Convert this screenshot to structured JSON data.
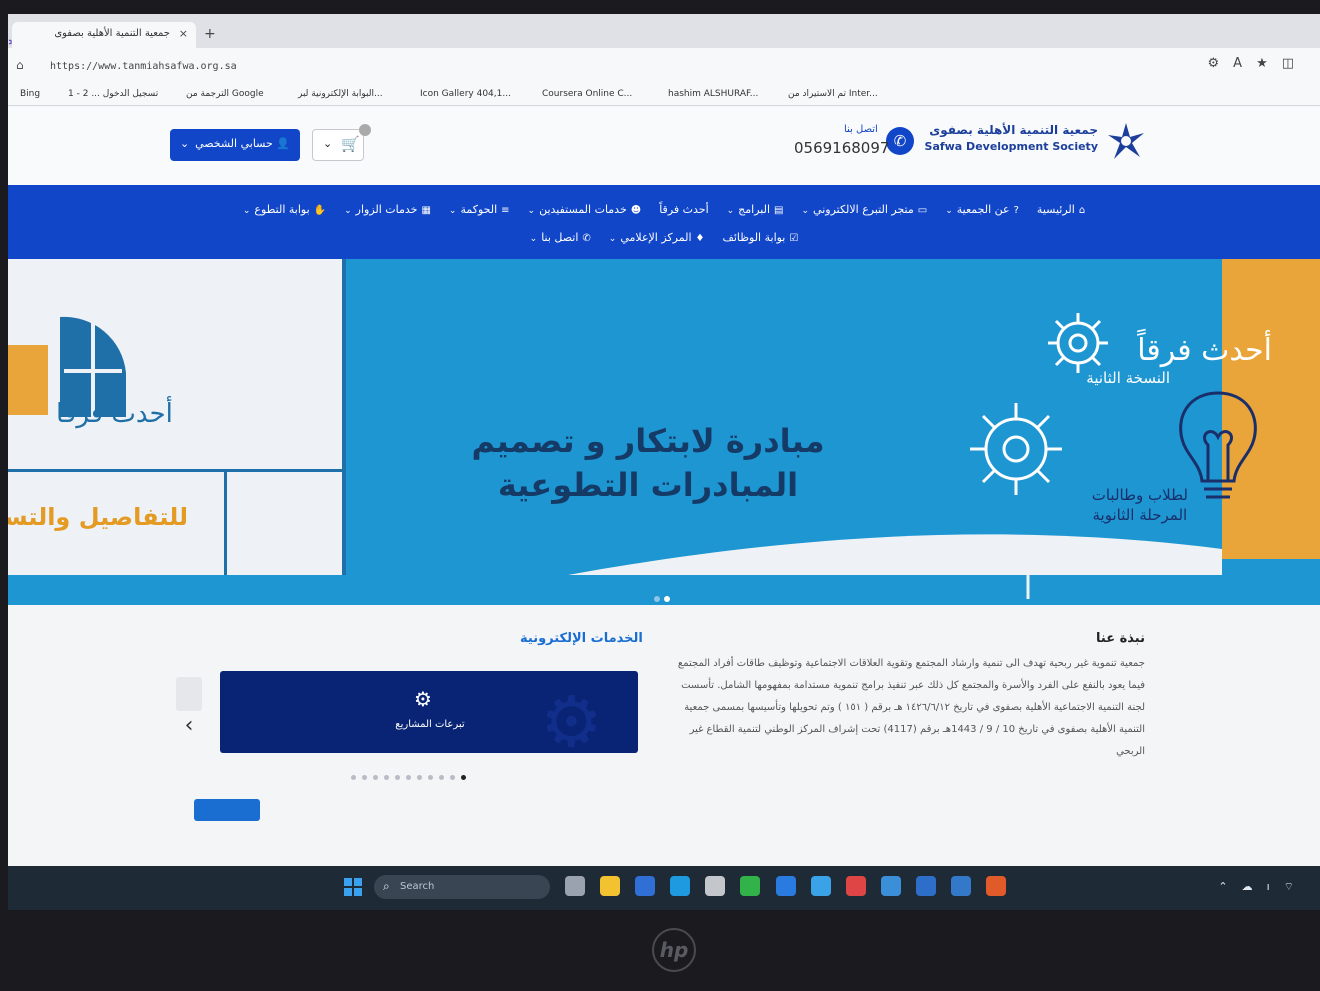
{
  "browser": {
    "tab_title": "جمعية التنمية الأهلية بصفوى",
    "tab_close": "×",
    "new_tab": "+",
    "url": "https://www.tanmiahsafwa.org.sa",
    "bookmarks": [
      "Bing",
      "تسجيل الدخول ... 2 - 1",
      "الترجمة من Google",
      "البوابة الإلكترونية لبر...",
      "Icon Gallery 404,1...",
      "Coursera Online C...",
      "hashim ALSHURAF...",
      "تم الاستيراد من Inter..."
    ]
  },
  "header": {
    "org_name_ar": "جمعية التنمية الأهلية بصفوى",
    "org_name_en": "Safwa Development Society",
    "contact_label": "اتصل بنا",
    "phone": "0569168097",
    "account_label": "حسابي الشخصي",
    "brand_color": "#1146c8"
  },
  "nav": {
    "row1": [
      {
        "label": "الرئيسية",
        "icon": "home-icon",
        "dropdown": false
      },
      {
        "label": "عن الجمعية",
        "icon": "question-icon",
        "dropdown": true
      },
      {
        "label": "متجر التبرع الالكتروني",
        "icon": "card-icon",
        "dropdown": true
      },
      {
        "label": "البرامج",
        "icon": "book-icon",
        "dropdown": true
      },
      {
        "label": "أحدث فرقاً",
        "icon": "",
        "dropdown": false
      },
      {
        "label": "خدمات المستفيدين",
        "icon": "users-icon",
        "dropdown": true
      },
      {
        "label": "الحوكمة",
        "icon": "list-icon",
        "dropdown": true
      },
      {
        "label": "خدمات الزوار",
        "icon": "grid-icon",
        "dropdown": true
      },
      {
        "label": "بوابة التطوع",
        "icon": "hand-icon",
        "dropdown": true
      }
    ],
    "row2": [
      {
        "label": "بوابة الوظائف",
        "icon": "check-icon",
        "dropdown": false
      },
      {
        "label": "المركز الإعلامي",
        "icon": "mic-icon",
        "dropdown": true
      },
      {
        "label": "اتصل بنا",
        "icon": "phone-icon",
        "dropdown": true
      }
    ]
  },
  "hero": {
    "title_line1": "مبادرة لابتكار و تصميم",
    "title_line2": "المبادرات التطوعية",
    "newest": "أحدث فرقاً",
    "edition": "النسخة الثانية",
    "students_line1": "لطلاب وطالبات",
    "students_line2": "المرحلة الثانوية",
    "left_title": "أحدث فرقا",
    "left_details": "للتفاصيل والتسجيل",
    "slides_total": 2,
    "slide_active": 2
  },
  "about": {
    "title": "نبذة عنا",
    "text": "جمعية تنموية غير ربحية تهدف الى تنمية وارشاد المجتمع وتقوية العلاقات الاجتماعية وتوظيف طاقات أفراد المجتمع فيما يعود بالنفع على الفرد والأسرة والمجتمع كل ذلك عبر تنفيذ برامج تنموية مستدامة بمفهومها الشامل. تأسست لجنة التنمية الاجتماعية الأهلية بصفوى في تاريخ ١٤٢٦/٦/١٢ هـ برقم ( ١٥١ ) وتم تحويلها وتأسيسها بمسمى جمعية التنمية الأهلية بصفوى في تاريخ 10 / 9 / 1443هـ برقم (4117) تحت إشراف المركز الوطني لتنمية القطاع غير الربحي"
  },
  "services": {
    "title": "الخدمات الإلكترونية",
    "card_label": "تبرعات المشاريع",
    "dots_total": 11,
    "dot_active": 11
  },
  "taskbar": {
    "search_placeholder": "Search"
  },
  "device": {
    "brand": "hp"
  }
}
